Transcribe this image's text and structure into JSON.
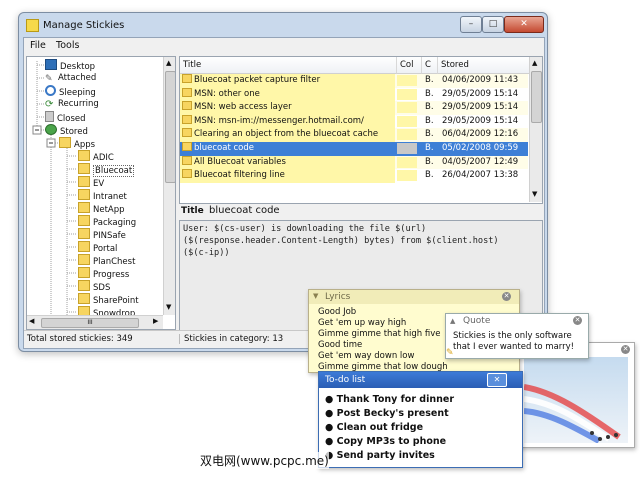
{
  "window": {
    "title": "Manage Stickies",
    "close_label": "✕",
    "min_label": "–",
    "max_label": "□"
  },
  "menu": [
    "File",
    "Tools"
  ],
  "tree": {
    "items": [
      "Desktop",
      "Attached",
      "Sleeping",
      "Recurring",
      "Closed",
      "Stored",
      "Apps",
      "ADIC",
      "Bluecoat",
      "EV",
      "Intranet",
      "NetApp",
      "Packaging",
      "PINSafe",
      "Portal",
      "PlanChest",
      "Progress",
      "SDS",
      "SharePoint",
      "Snowdrop"
    ],
    "selected": "Bluecoat",
    "hscroll_label": "III"
  },
  "list": {
    "columns": [
      "Title",
      "Col",
      "C",
      "Stored"
    ],
    "rows": [
      {
        "title": "Bluecoat packet capture filter",
        "c": "B.",
        "stored": "04/06/2009 11:43",
        "color": "#fff7a8"
      },
      {
        "title": "MSN: other one",
        "c": "B.",
        "stored": "29/05/2009 15:14",
        "color": "#fff7a8"
      },
      {
        "title": "MSN: web access layer",
        "c": "B.",
        "stored": "29/05/2009 15:14",
        "color": "#fff7a8"
      },
      {
        "title": "MSN: msn-im://messenger.hotmail.com/",
        "c": "B.",
        "stored": "29/05/2009 15:14",
        "color": "#fff7a8"
      },
      {
        "title": "Clearing an object from the bluecoat cache",
        "c": "B.",
        "stored": "06/04/2009 12:16",
        "color": "#fff7a8"
      },
      {
        "title": "bluecoat code",
        "c": "B.",
        "stored": "05/02/2008 09:59",
        "color": "#c8c8c8"
      },
      {
        "title": "All Bluecoat variables",
        "c": "B.",
        "stored": "04/05/2007 12:49",
        "color": "#fff7a8"
      },
      {
        "title": "Bluecoat filtering line",
        "c": "B.",
        "stored": "26/04/2007 13:38",
        "color": "#fff7a8"
      }
    ],
    "selected_index": 5
  },
  "title_field": {
    "label": "Title",
    "value": "bluecoat code"
  },
  "editor": {
    "lines": [
      "User: $(cs-user) is downloading the file $(url)",
      "($(response.header.Content-Length) bytes) from $(client.host)",
      "($(c-ip))"
    ]
  },
  "status": {
    "left": "Total stored stickies: 349",
    "right": "Stickies in category: 13"
  },
  "lyrics": {
    "title": "Lyrics",
    "lines": [
      "Good Job",
      "Get 'em up way high",
      "Gimme gimme that high five",
      "Good time",
      "Get 'em way down low",
      "Gimme gimme that low dough"
    ]
  },
  "quote": {
    "title": "Quote",
    "text1": "Stickies is the only software",
    "text2": "that I ever wanted to marry!"
  },
  "todo": {
    "title": "To-do list",
    "items": [
      "Thank Tony for dinner",
      "Post Becky's present",
      "Clean out fridge",
      "Copy MP3s to phone",
      "Send party invites"
    ]
  },
  "watermark": "双电网(www.pcpc.me)",
  "colors": {
    "selection": "#3d7fd6",
    "sticky_yellow": "#fff7a8",
    "todo_header": "#2f63be"
  }
}
